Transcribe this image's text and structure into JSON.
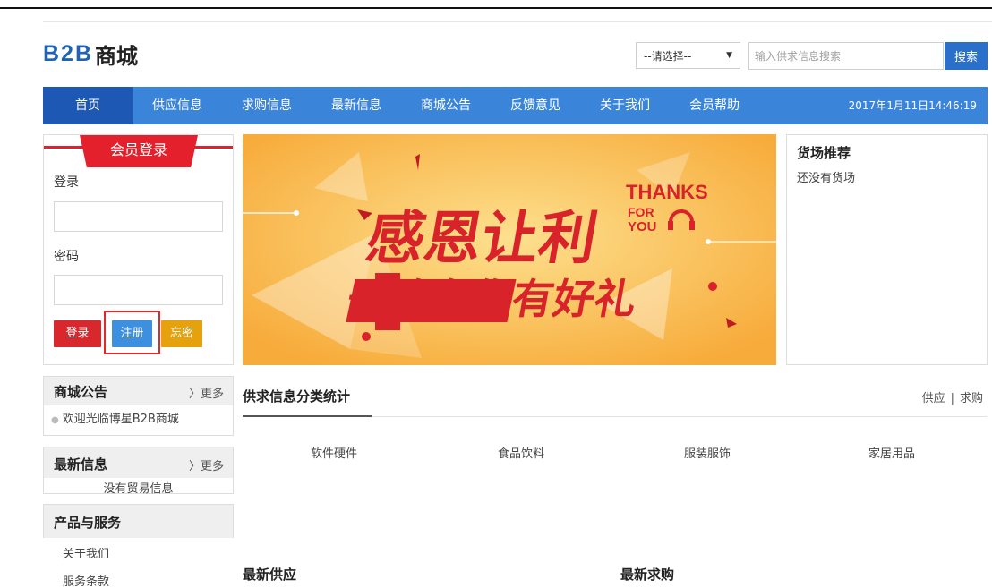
{
  "header": {
    "logo_b2b": "B2B",
    "logo_mall": "商城",
    "select_value": "--请选择--",
    "search_placeholder": "输入供求信息搜索",
    "search_button": "搜索"
  },
  "nav": {
    "items": [
      {
        "label": "首页",
        "active": true
      },
      {
        "label": "供应信息"
      },
      {
        "label": "求购信息"
      },
      {
        "label": "最新信息"
      },
      {
        "label": "商城公告"
      },
      {
        "label": "反馈意见"
      },
      {
        "label": "关于我们"
      },
      {
        "label": "会员帮助"
      }
    ],
    "datetime": "2017年1月11日14:46:19"
  },
  "login": {
    "title": "会员登录",
    "username_label": "登录",
    "password_label": "密码",
    "login_button": "登录",
    "register_button": "注册",
    "forgot_button": "忘密"
  },
  "banner": {
    "line1": "感恩让利",
    "line2": "一路有你有好礼",
    "thanks": "THANKS",
    "for": "FOR",
    "you": "YOU"
  },
  "market": {
    "title": "货场推荐",
    "empty": "还没有货场"
  },
  "notice_panel": {
    "title": "商城公告",
    "more": "更多",
    "items": [
      "欢迎光临博星B2B商城"
    ]
  },
  "latest_panel": {
    "title": "最新信息",
    "more": "更多",
    "empty": "没有贸易信息"
  },
  "products_panel": {
    "title": "产品与服务",
    "items": [
      "关于我们",
      "服务条款"
    ]
  },
  "stats": {
    "title": "供求信息分类统计",
    "link_supply": "供应",
    "link_demand": "求购",
    "categories": [
      "软件硬件",
      "食品饮料",
      "服装服饰",
      "家居用品"
    ]
  },
  "sections": {
    "latest_supply": "最新供应",
    "latest_demand": "最新求购"
  },
  "colors": {
    "brand_blue": "#1f64b4",
    "nav_blue": "#3a85d9",
    "nav_active": "#1c58b4",
    "red": "#e3202b",
    "orange": "#e6a20c"
  }
}
